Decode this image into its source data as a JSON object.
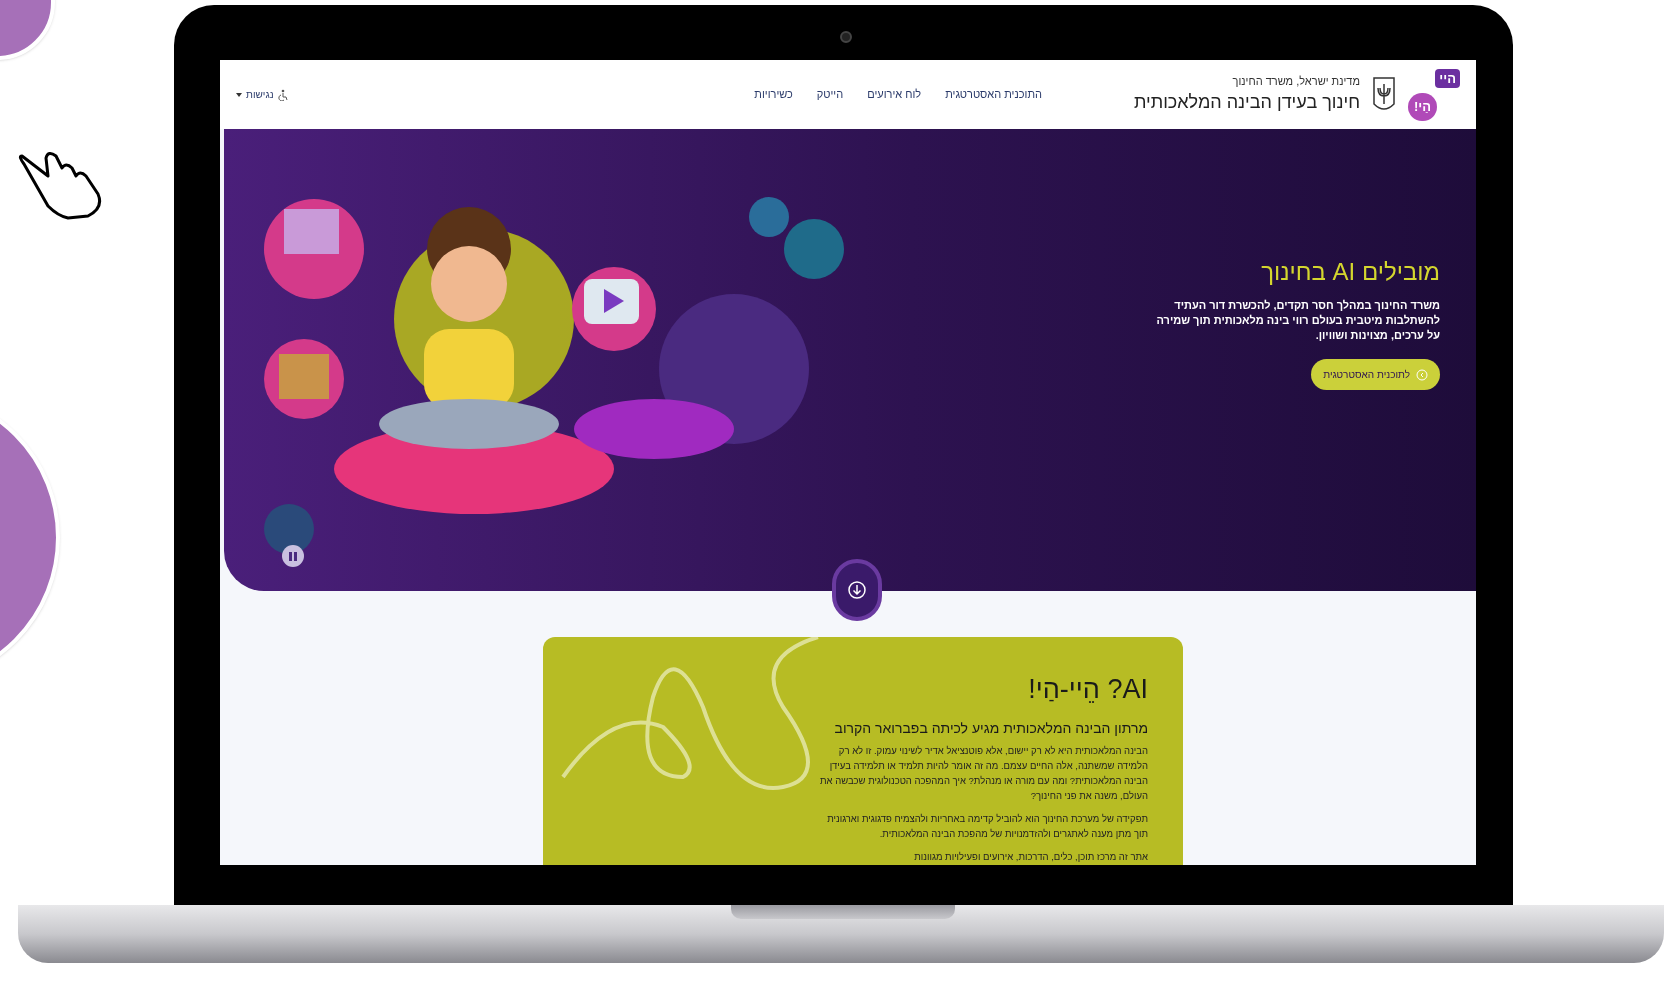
{
  "header": {
    "logo_badge_top": "היי",
    "logo_badge_bottom": "הַי!",
    "ministry": "מדינת ישראל, משרד החינוך",
    "site_title": "חינוך בעידן הבינה המלאכותית",
    "nav": [
      {
        "label": "התוכנית האסטרטגית"
      },
      {
        "label": "לוח אירועים"
      },
      {
        "label": "הייטק"
      },
      {
        "label": "כשירויות"
      }
    ],
    "accessibility": "נגישות"
  },
  "hero": {
    "title": "מובילים AI בחינוך",
    "text": "משרד החינוך במהלך חסר תקדים, להכשרת דור העתיד להשתלבות מיטבית בעולם רווי בינה מלאכותית תוך שמירה על ערכים, מצוינות ושוויון.",
    "button": "לתוכנית האסטרטגית"
  },
  "card": {
    "title": "AI? הֵיי-הַי!",
    "subtitle": "מרתון הבינה המלאכותית מגיע לכיתה בפברואר הקרוב",
    "paragraphs": [
      "הבינה המלאכותית היא לא רק יישום, אלא פוטנציאל אדיר לשינוי עמוק. זו לא רק הלמידה שמשתנה, אלה החיים עצמם. מה זה אומר להיות תלמיד או תלמידה בעידן הבינה המלאכותית? ומה עם מורה או מנהלת? איך המהפכה הטכנולוגית שכבשה את העולם, משנה את פני החינוך?",
      "תפקידה של מערכת החינוך הוא להוביל קדימה באחריות ולהצמיח פדגוגית וארגונית תוך מתן מענה לאתגרים ולהזדמנויות של מהפכת הבינה המלאכותית.",
      "אתר זה מרכז תוכן, כלים, הדרכות, אירועים ופעילויות מגוונות"
    ]
  }
}
